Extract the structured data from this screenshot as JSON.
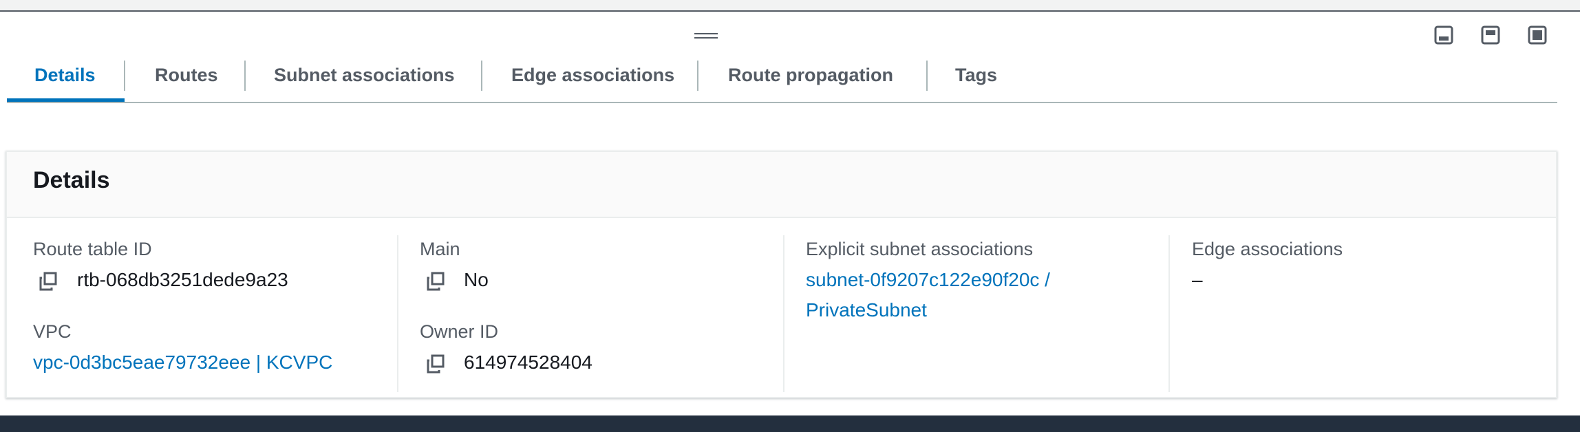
{
  "tabs": [
    {
      "label": "Details",
      "active": true
    },
    {
      "label": "Routes",
      "active": false
    },
    {
      "label": "Subnet associations",
      "active": false
    },
    {
      "label": "Edge associations",
      "active": false
    },
    {
      "label": "Route propagation",
      "active": false
    },
    {
      "label": "Tags",
      "active": false
    }
  ],
  "panel_controls": [
    "panel-bottom-icon",
    "panel-side-icon",
    "panel-full-icon"
  ],
  "details": {
    "title": "Details",
    "route_table_id_label": "Route table ID",
    "route_table_id": "rtb-068db3251dede9a23",
    "vpc_label": "VPC",
    "vpc": "vpc-0d3bc5eae79732eee | KCVPC",
    "main_label": "Main",
    "main": "No",
    "owner_id_label": "Owner ID",
    "owner_id": "614974528404",
    "explicit_subnet_label": "Explicit subnet associations",
    "explicit_subnet_line1": "subnet-0f9207c122e90f20c /",
    "explicit_subnet_line2": "PrivateSubnet",
    "edge_associations_label": "Edge associations",
    "edge_associations": "–"
  },
  "colors": {
    "accent": "#0073bb",
    "text": "#16191f",
    "muted": "#545b64",
    "footer": "#232f3e"
  }
}
